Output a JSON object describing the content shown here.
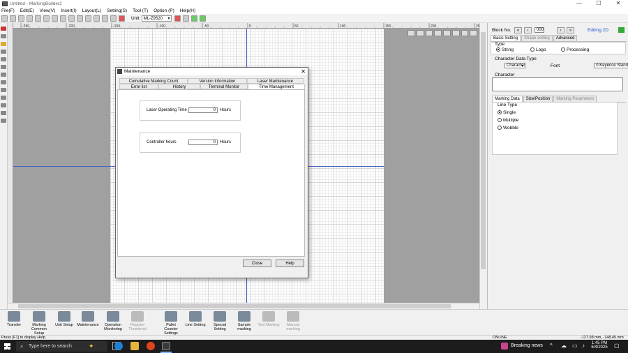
{
  "window": {
    "title": "Untitled - MarkingBuilder2",
    "min": "—",
    "max": "☐",
    "close": "✕"
  },
  "menu": [
    "File(F)",
    "Edit(E)",
    "View(V)",
    "Insert(I)",
    "Layout(L)",
    "Setting(S)",
    "Tool (T)",
    "Option (P)",
    "Help(H)"
  ],
  "toolbar": {
    "unit_label": "Unit",
    "unit_value": "ML-Z9520"
  },
  "ruler": {
    "h_ticks": [
      "-250",
      "-200",
      "-150",
      "-100",
      "-50",
      "0",
      "50",
      "100",
      "150",
      "200",
      "250"
    ]
  },
  "right_panel": {
    "block_no_label": "Block No.",
    "block_no_value": "000",
    "editing_label": "Editing 2D",
    "tabs": [
      "Basic Setting",
      "Shape setting",
      "Advanced"
    ],
    "type_label": "Type",
    "type_options": [
      "String",
      "Logo",
      "Processing"
    ],
    "char_data_type_label": "Character Data Type",
    "char_data_type_value": "Character",
    "font_label": "Font",
    "font_value": "0:Keyence Standard",
    "character_label": "Character",
    "sub_tabs": [
      "Marking Data",
      "Size/Position",
      "Marking Parameters"
    ],
    "line_type_label": "Line Type",
    "line_types": [
      "Single",
      "Multiple",
      "Wobble"
    ]
  },
  "dialog": {
    "title": "Maintenance",
    "close": "✕",
    "tabs_row1": [
      "Cumulative Marking Count",
      "Version Information",
      "Laser Maintenance"
    ],
    "tabs_row2": [
      "Error list",
      "History",
      "Terminal Monitor",
      "Time Management"
    ],
    "laser_label": "Laser Operating Time",
    "laser_value": "0",
    "laser_unit": "Hours",
    "controller_label": "Controller hours",
    "controller_value": "0",
    "controller_unit": "Hours",
    "close_button": "Close",
    "help_button": "Help"
  },
  "bottom_buttons": [
    {
      "label": "Transfer",
      "enabled": true
    },
    {
      "label": "Marking Common Setup",
      "enabled": true
    },
    {
      "label": "Unit Setup",
      "enabled": true
    },
    {
      "label": "Maintenance",
      "enabled": true
    },
    {
      "label": "Operation Monitoring",
      "enabled": true
    },
    {
      "label": "Register Thumbnail",
      "enabled": false
    },
    {
      "label": "Pallet Counter Settings",
      "enabled": true
    },
    {
      "label": "Line Setting",
      "enabled": true
    },
    {
      "label": "Special Setting",
      "enabled": true
    },
    {
      "label": "Sample marking",
      "enabled": true
    },
    {
      "label": "Test Marking",
      "enabled": false
    },
    {
      "label": "Manual marking",
      "enabled": false
    }
  ],
  "status": {
    "help": "Press [F1] to display Help.",
    "online": "ONLINE",
    "coords": "-127.98 mm, -148.45 mm"
  },
  "taskbar": {
    "search_placeholder": "Type here to search",
    "news": "Breaking news",
    "time": "1:45 PM",
    "date": "6/4/2025"
  }
}
